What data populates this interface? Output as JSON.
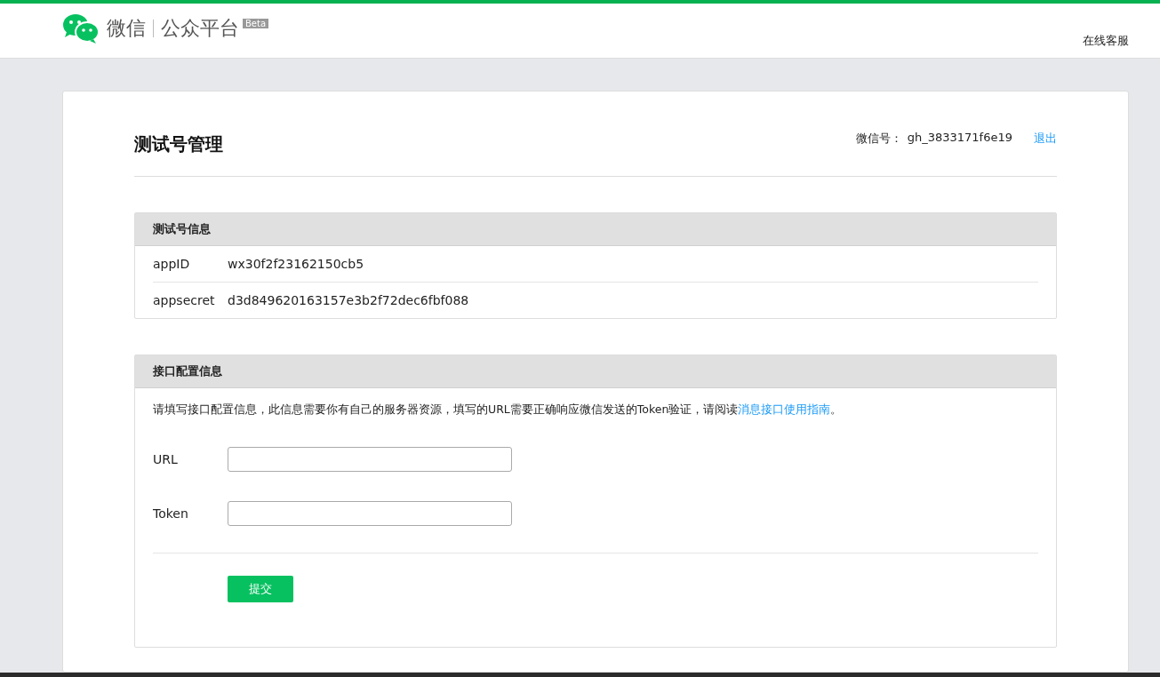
{
  "header": {
    "brand": "微信",
    "product": "公众平台",
    "badge": "Beta",
    "help_link": "在线客服"
  },
  "page": {
    "title": "测试号管理",
    "account_label": "微信号：",
    "account_id": "gh_3833171f6e19",
    "logout": "退出"
  },
  "test_account": {
    "title": "测试号信息",
    "fields": [
      {
        "label": "appID",
        "value": "wx30f2f23162150cb5"
      },
      {
        "label": "appsecret",
        "value": "d3d849620163157e3b2f72dec6fbf088"
      }
    ]
  },
  "interface_config": {
    "title": "接口配置信息",
    "description": "请填写接口配置信息，此信息需要你有自己的服务器资源，填写的URL需要正确响应微信发送的Token验证，请阅读",
    "link": "消息接口使用指南",
    "description_end": "。",
    "inputs": [
      {
        "label": "URL"
      },
      {
        "label": "Token"
      }
    ],
    "submit": "提交"
  }
}
